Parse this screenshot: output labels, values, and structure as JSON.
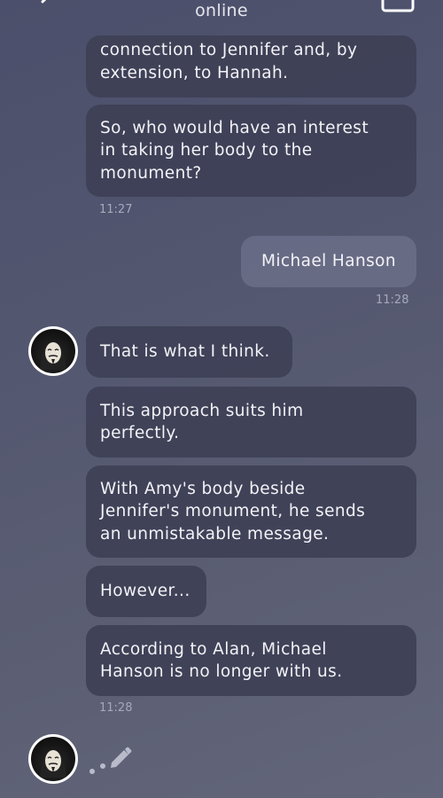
{
  "header": {
    "status": "online"
  },
  "messages": [
    {
      "from": "them",
      "text": "connection to Jennifer and, by\nextension, to Hannah."
    },
    {
      "from": "them",
      "text": "So, who would have an interest\nin taking her body to the\nmonument?"
    },
    {
      "from": "me",
      "text": "Michael Hanson"
    },
    {
      "from": "them",
      "text": "That is what I think."
    },
    {
      "from": "them",
      "text": "This approach suits him\nperfectly."
    },
    {
      "from": "them",
      "text": "With Amy's body beside\nJennifer's monument, he sends\nan unmistakable message."
    },
    {
      "from": "them",
      "text": "However..."
    },
    {
      "from": "them",
      "text": "According to Alan, Michael\nHanson is no longer with us."
    }
  ],
  "timestamps": [
    "11:27",
    "11:28",
    "11:28"
  ],
  "icons": {
    "back": "chevron-left-icon",
    "menu": "cards-icon",
    "typing": "pencil-icon",
    "avatar": "masked-figure-avatar"
  }
}
